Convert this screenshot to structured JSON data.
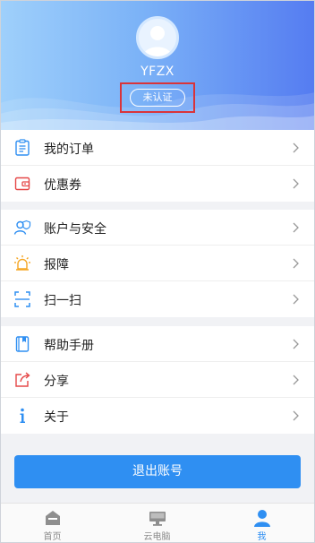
{
  "profile": {
    "username": "YFZX",
    "status": "未认证"
  },
  "menu": {
    "group1": [
      {
        "label": "我的订单",
        "icon": "orders-icon"
      },
      {
        "label": "优惠券",
        "icon": "coupon-icon"
      }
    ],
    "group2": [
      {
        "label": "账户与安全",
        "icon": "account-security-icon"
      },
      {
        "label": "报障",
        "icon": "alarm-icon"
      },
      {
        "label": "扫一扫",
        "icon": "scan-icon"
      }
    ],
    "group3": [
      {
        "label": "帮助手册",
        "icon": "help-book-icon"
      },
      {
        "label": "分享",
        "icon": "share-icon"
      },
      {
        "label": "关于",
        "icon": "info-icon"
      }
    ]
  },
  "logout_label": "退出账号",
  "tabbar": [
    {
      "label": "首页",
      "icon": "home-icon",
      "active": false
    },
    {
      "label": "云电脑",
      "icon": "monitor-icon",
      "active": false
    },
    {
      "label": "我",
      "icon": "user-icon",
      "active": true
    }
  ],
  "colors": {
    "accent": "#2f8ff2",
    "header_start": "#9fd0fb",
    "header_end": "#557cf1",
    "highlight_box": "#d9343a"
  }
}
